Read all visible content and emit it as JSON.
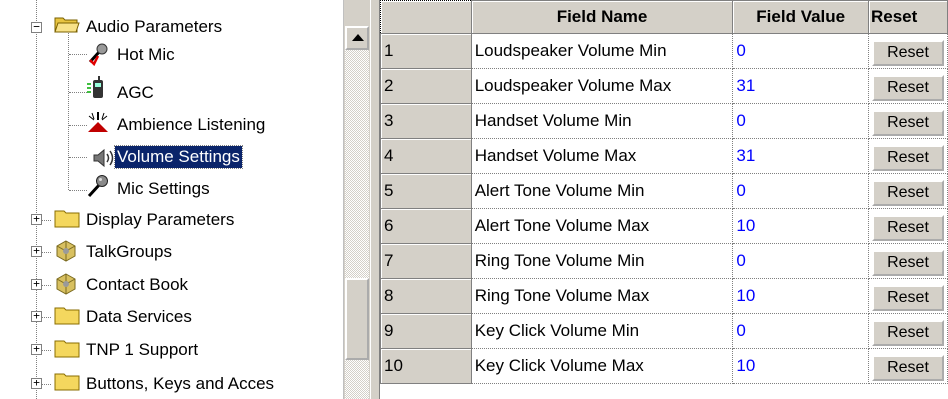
{
  "tree": {
    "items": [
      {
        "label": "Audio Parameters",
        "level": 0,
        "expander": "minus",
        "icon": "folder-open-icon"
      },
      {
        "label": "Hot Mic",
        "level": 1,
        "icon": "microphone-red-icon"
      },
      {
        "label": "AGC",
        "level": 1,
        "icon": "radio-handset-icon"
      },
      {
        "label": "Ambience Listening",
        "level": 1,
        "icon": "ambience-icon"
      },
      {
        "label": "Volume Settings",
        "level": 1,
        "icon": "speaker-volume-icon",
        "selected": true
      },
      {
        "label": "Mic Settings",
        "level": 1,
        "icon": "microphone-icon"
      },
      {
        "label": "Display Parameters",
        "level": 0,
        "expander": "plus",
        "icon": "folder-icon"
      },
      {
        "label": "TalkGroups",
        "level": 0,
        "expander": "plus",
        "icon": "talkgroup-icon"
      },
      {
        "label": "Contact Book",
        "level": 0,
        "expander": "plus",
        "icon": "talkgroup-icon"
      },
      {
        "label": "Data Services",
        "level": 0,
        "expander": "plus",
        "icon": "folder-icon"
      },
      {
        "label": "TNP 1 Support",
        "level": 0,
        "expander": "plus",
        "icon": "folder-icon"
      },
      {
        "label": "Buttons, Keys and Acces",
        "level": 0,
        "expander": "plus",
        "icon": "folder-icon"
      }
    ]
  },
  "grid": {
    "columns": [
      "Field Name",
      "Field Value",
      "Reset"
    ],
    "rows": [
      {
        "num": "1",
        "name": "Loudspeaker Volume Min",
        "value": "0",
        "reset": "Reset"
      },
      {
        "num": "2",
        "name": "Loudspeaker Volume Max",
        "value": "31",
        "reset": "Reset"
      },
      {
        "num": "3",
        "name": "Handset Volume Min",
        "value": "0",
        "reset": "Reset"
      },
      {
        "num": "4",
        "name": "Handset Volume Max",
        "value": "31",
        "reset": "Reset"
      },
      {
        "num": "5",
        "name": "Alert Tone Volume Min",
        "value": "0",
        "reset": "Reset"
      },
      {
        "num": "6",
        "name": "Alert Tone Volume Max",
        "value": "10",
        "reset": "Reset"
      },
      {
        "num": "7",
        "name": "Ring Tone Volume Min",
        "value": "0",
        "reset": "Reset"
      },
      {
        "num": "8",
        "name": "Ring Tone Volume Max",
        "value": "10",
        "reset": "Reset"
      },
      {
        "num": "9",
        "name": "Key Click Volume Min",
        "value": "0",
        "reset": "Reset"
      },
      {
        "num": "10",
        "name": "Key Click Volume Max",
        "value": "10",
        "reset": "Reset"
      }
    ]
  },
  "colors": {
    "selection": "#0a246a",
    "value_text": "#0000ff",
    "chrome": "#d4d0c8",
    "folder": "#f4d75e"
  }
}
